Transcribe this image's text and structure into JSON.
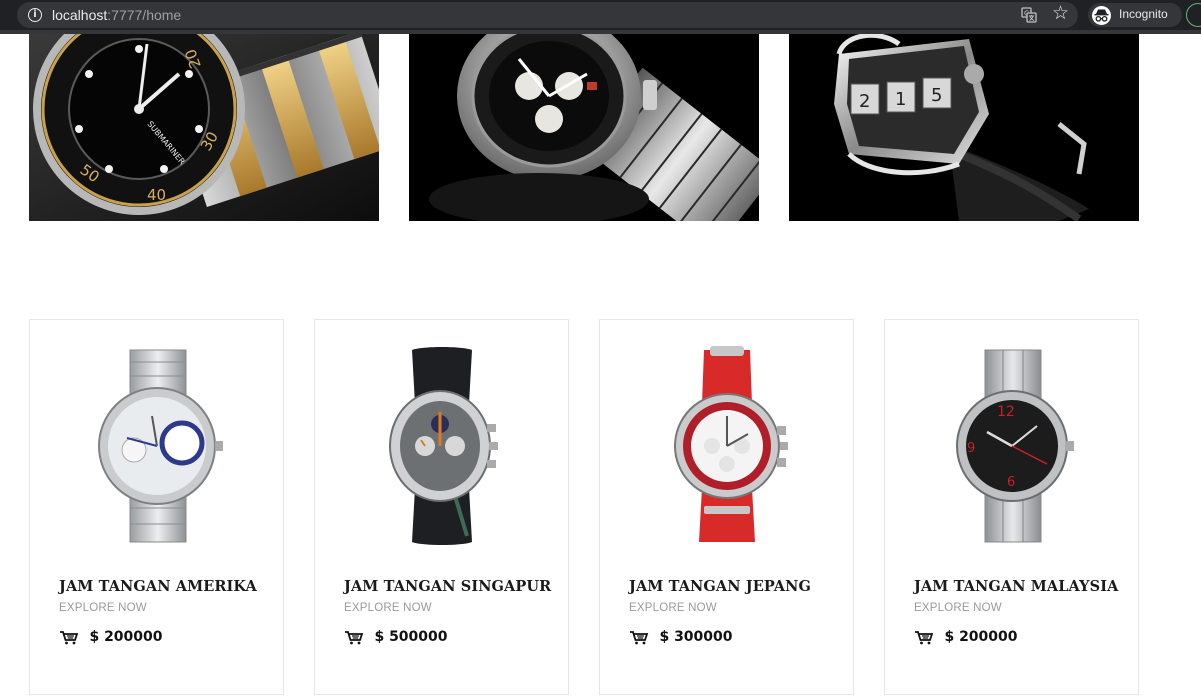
{
  "browser": {
    "url_host": "localhost",
    "url_rest": ":7777/home",
    "profile_label": "Incognito"
  },
  "banners": [
    {
      "name": "banner-gold-diver-watch"
    },
    {
      "name": "banner-chronograph-watch"
    },
    {
      "name": "banner-skeleton-watch"
    }
  ],
  "products": [
    {
      "title": "JAM TANGAN AMERIKA",
      "explore": "EXPLORE NOW",
      "price": "$ 200000",
      "strap_color": "#c4c6c8",
      "dial_color": "#e9ecef",
      "accent": "#2d3a8c"
    },
    {
      "title": "JAM TANGAN SINGAPUR",
      "explore": "EXPLORE NOW",
      "price": "$ 500000",
      "strap_color": "#1d1f22",
      "dial_color": "#6d7073",
      "accent": "#e07a1f"
    },
    {
      "title": "JAM TANGAN JEPANG",
      "explore": "EXPLORE NOW",
      "price": "$ 300000",
      "strap_color": "#d92a2a",
      "dial_color": "#f4f4f4",
      "accent": "#b01e2a"
    },
    {
      "title": "JAM TANGAN MALAYSIA",
      "explore": "EXPLORE NOW",
      "price": "$ 200000",
      "strap_color": "#b9bcbf",
      "dial_color": "#1c1c1c",
      "accent": "#c8202a"
    }
  ]
}
